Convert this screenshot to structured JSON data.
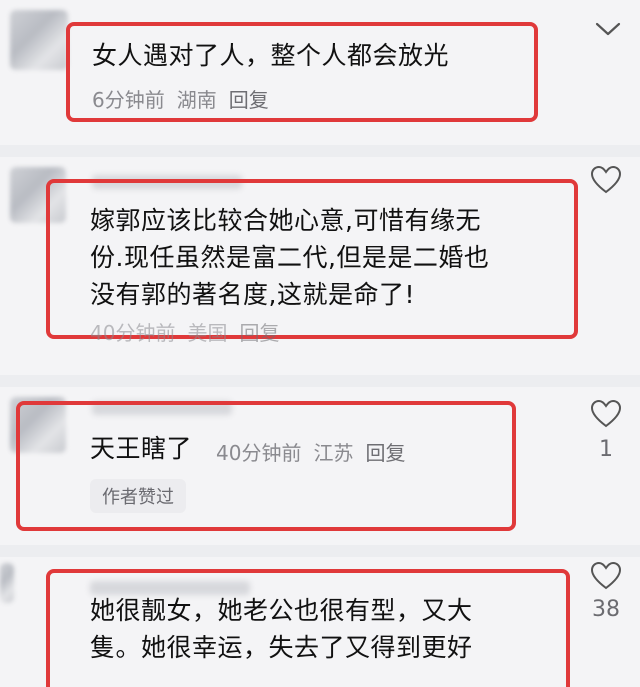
{
  "comments": [
    {
      "text": "女人遇对了人，整个人都会放光",
      "time": "6分钟前",
      "location": "湖南",
      "reply": "回复"
    },
    {
      "text_lines": [
        "嫁郭应该比较合她心意,可惜有缘无",
        "份.现任虽然是富二代,但是是二婚也",
        "没有郭的著名度,这就是命了!"
      ],
      "time": "40分钟前",
      "location": "美国",
      "reply": "回复"
    },
    {
      "text": "天王瞎了",
      "time": "40分钟前",
      "location": "江苏",
      "reply": "回复",
      "badge": "作者赞过",
      "likes": "1"
    },
    {
      "text_lines": [
        "她很靓女，她老公也很有型，又大",
        "隻。她很幸运，失去了又得到更好"
      ],
      "likes": "38"
    }
  ]
}
